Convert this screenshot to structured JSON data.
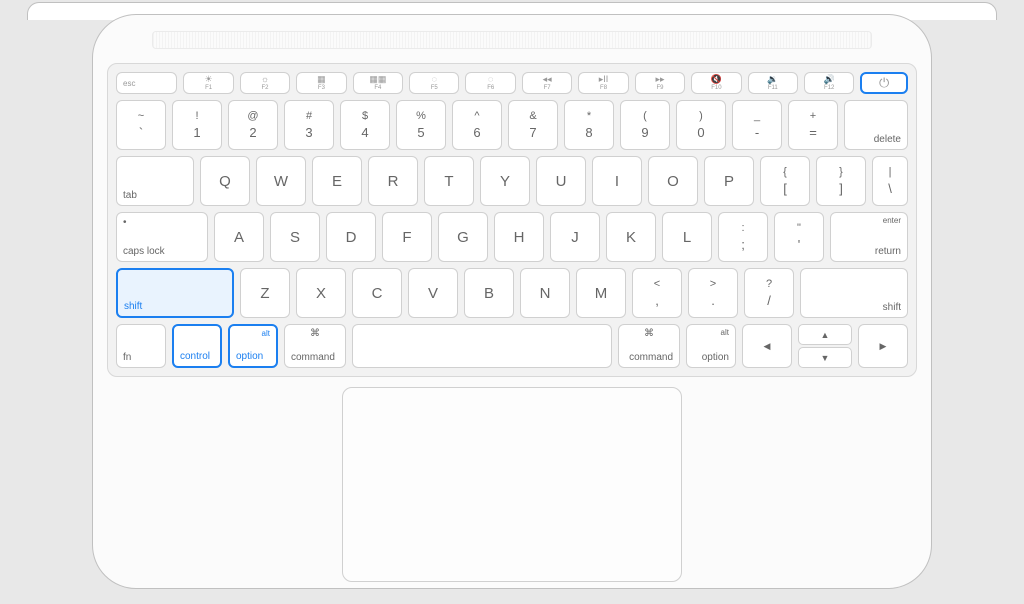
{
  "fn_row": {
    "esc": "esc",
    "keys": [
      {
        "sym": "☀",
        "lbl": "F1"
      },
      {
        "sym": "☼",
        "lbl": "F2"
      },
      {
        "sym": "▦",
        "lbl": "F3"
      },
      {
        "sym": "▦▦",
        "lbl": "F4"
      },
      {
        "sym": "◌",
        "lbl": "F5"
      },
      {
        "sym": "◌",
        "lbl": "F6"
      },
      {
        "sym": "◂◂",
        "lbl": "F7"
      },
      {
        "sym": "▸II",
        "lbl": "F8"
      },
      {
        "sym": "▸▸",
        "lbl": "F9"
      },
      {
        "sym": "🔇",
        "lbl": "F10"
      },
      {
        "sym": "🔉",
        "lbl": "F11"
      },
      {
        "sym": "🔊",
        "lbl": "F12"
      }
    ],
    "power": "⏻"
  },
  "row1": {
    "keys": [
      {
        "t": "~",
        "b": "`"
      },
      {
        "t": "!",
        "b": "1"
      },
      {
        "t": "@",
        "b": "2"
      },
      {
        "t": "#",
        "b": "3"
      },
      {
        "t": "$",
        "b": "4"
      },
      {
        "t": "%",
        "b": "5"
      },
      {
        "t": "^",
        "b": "6"
      },
      {
        "t": "&",
        "b": "7"
      },
      {
        "t": "*",
        "b": "8"
      },
      {
        "t": "(",
        "b": "9"
      },
      {
        "t": ")",
        "b": "0"
      },
      {
        "t": "_",
        "b": "-"
      },
      {
        "t": "+",
        "b": "="
      }
    ],
    "delete": "delete"
  },
  "row2": {
    "tab": "tab",
    "keys": [
      "Q",
      "W",
      "E",
      "R",
      "T",
      "Y",
      "U",
      "I",
      "O",
      "P"
    ],
    "brackets": [
      {
        "t": "{",
        "b": "["
      },
      {
        "t": "}",
        "b": "]"
      },
      {
        "t": "|",
        "b": "\\"
      }
    ]
  },
  "row3": {
    "caps_sym": "•",
    "caps": "caps lock",
    "keys": [
      "A",
      "S",
      "D",
      "F",
      "G",
      "H",
      "J",
      "K",
      "L"
    ],
    "punct": [
      {
        "t": ":",
        "b": ";"
      },
      {
        "t": "\"",
        "b": "'"
      }
    ],
    "enter_top": "enter",
    "enter": "return"
  },
  "row4": {
    "lshift": "shift",
    "keys": [
      "Z",
      "X",
      "C",
      "V",
      "B",
      "N",
      "M"
    ],
    "punct": [
      {
        "t": "<",
        "b": ","
      },
      {
        "t": ">",
        "b": "."
      },
      {
        "t": "?",
        "b": "/"
      }
    ],
    "rshift": "shift"
  },
  "row5": {
    "fn": "fn",
    "control": "control",
    "option_l_top": "alt",
    "option_l": "option",
    "command_l_sym": "⌘",
    "command_l": "command",
    "command_r_sym": "⌘",
    "command_r": "command",
    "option_r_top": "alt",
    "option_r": "option",
    "left": "◀",
    "up": "▲",
    "down": "▼",
    "right": "▶"
  }
}
